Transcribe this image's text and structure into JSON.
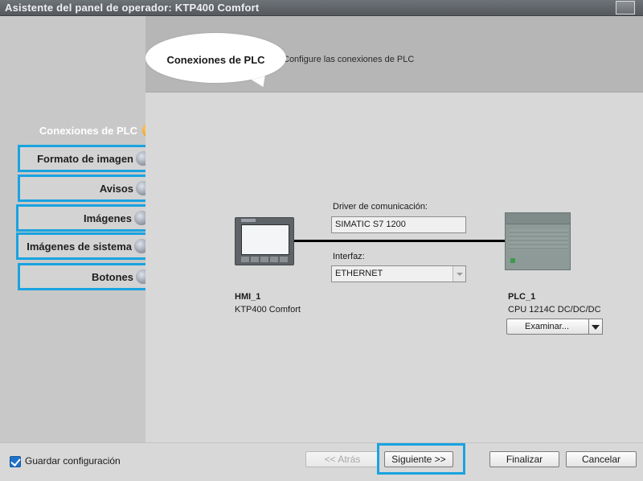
{
  "window": {
    "title": "Asistente del panel de operador: KTP400 Comfort"
  },
  "header": {
    "bubble_title": "Conexiones de PLC",
    "subtitle": "Configure las conexiones de PLC"
  },
  "sidebar": {
    "items": [
      {
        "label": "Conexiones de PLC",
        "state": "active"
      },
      {
        "label": "Formato de imagen",
        "state": "pending"
      },
      {
        "label": "Avisos",
        "state": "pending"
      },
      {
        "label": "Imágenes",
        "state": "pending"
      },
      {
        "label": "Imágenes de sistema",
        "state": "pending"
      },
      {
        "label": "Botones",
        "state": "pending"
      }
    ]
  },
  "connection": {
    "driver_label": "Driver de comunicación:",
    "driver_value": "SIMATIC S7 1200",
    "interface_label": "Interfaz:",
    "interface_value": "ETHERNET"
  },
  "hmi": {
    "name": "HMI_1",
    "type": "KTP400 Comfort"
  },
  "plc": {
    "name": "PLC_1",
    "type": "CPU 1214C DC/DC/DC",
    "browse_label": "Examinar..."
  },
  "footer": {
    "save_config_label": "Guardar configuración",
    "save_config_checked": true,
    "back_label": "<< Atrás",
    "next_label": "Siguiente >>",
    "finish_label": "Finalizar",
    "cancel_label": "Cancelar"
  },
  "colors": {
    "highlight": "#19a3e0",
    "active_dot": "#f4a21e",
    "pending_dot": "#8e95a3"
  }
}
